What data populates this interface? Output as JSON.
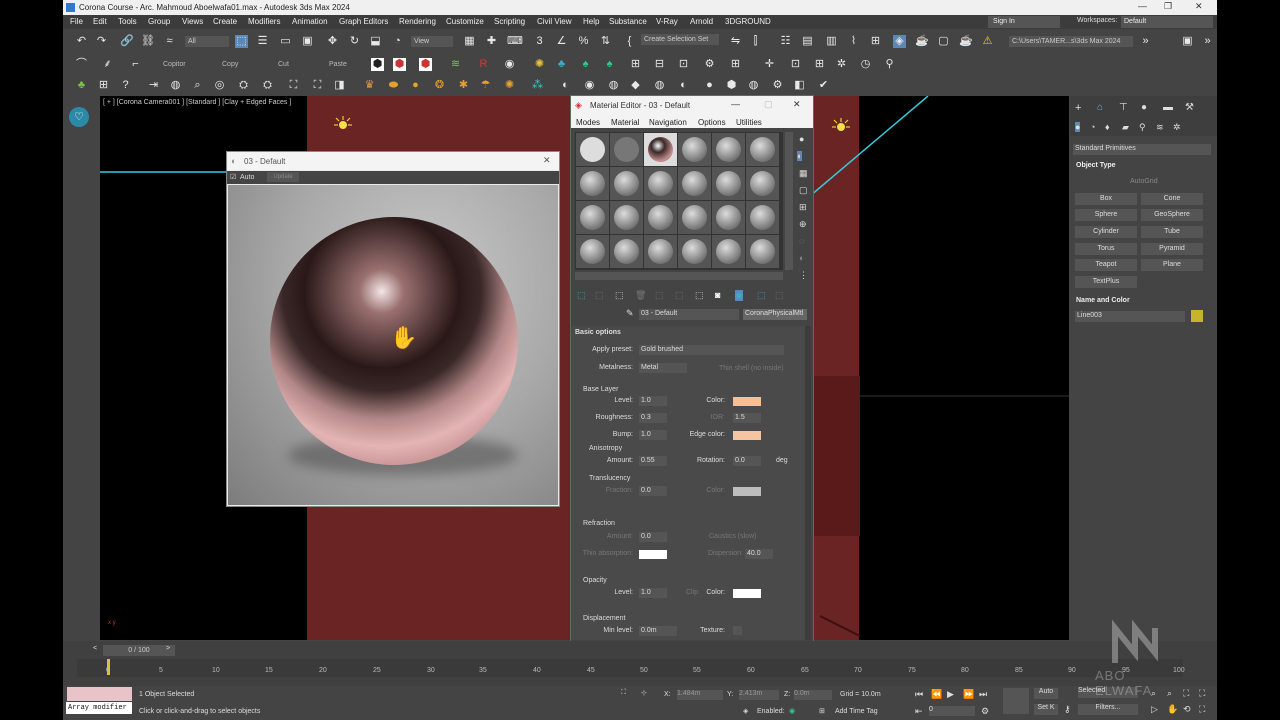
{
  "title_bar": {
    "text": "Corona Course - Arc. Mahmoud Aboelwafa01.max - Autodesk 3ds Max 2024",
    "controls": [
      "—",
      "❐",
      "✕"
    ]
  },
  "menu": {
    "items": [
      "File",
      "Edit",
      "Tools",
      "Group",
      "Views",
      "Create",
      "Modifiers",
      "Animation",
      "Graph Editors",
      "Rendering",
      "Customize",
      "Scripting",
      "Civil View",
      "Help",
      "Substance",
      "V-Ray",
      "Arnold",
      "3DGROUND"
    ],
    "sign_in": "Sign In",
    "workspaces_label": "Workspaces:",
    "workspaces_value": "Default"
  },
  "toolbar1": {
    "selection_filter": "All",
    "ref_coord": "View",
    "named_sel": "Create Selection Set",
    "path": "C:\\Users\\TAMER...s\\3ds Max 2024"
  },
  "toolbar2": {
    "labels": [
      "Copitor",
      "Copy",
      "Cut",
      "Paste"
    ]
  },
  "viewport": {
    "label": "[ + ] [Corona Camera001 ] [Standard ] [Clay + Edged Faces ]",
    "axis_label": "x y"
  },
  "preview_window": {
    "title": "03 - Default",
    "auto_label": "Auto",
    "update_label": "Update"
  },
  "material_editor": {
    "title": "Material Editor - 03 - Default",
    "menu": [
      "Modes",
      "Material",
      "Navigation",
      "Options",
      "Utilities"
    ],
    "material_name": "03 - Default",
    "material_type": "CoronaPhysicalMtl",
    "basic_options": "Basic options",
    "apply_preset_label": "Apply preset:",
    "apply_preset_value": "Gold brushed",
    "metalness_label": "Metalness:",
    "metalness_value": "Metal",
    "thin_shell": "Thin shell (no inside)",
    "base_layer": "Base Layer",
    "level_label": "Level:",
    "level_value": "1.0",
    "color_label": "Color:",
    "roughness_label": "Roughness:",
    "roughness_value": "0.3",
    "ior_label": "IOR:",
    "ior_value": "1.5",
    "bump_label": "Bump:",
    "bump_value": "1.0",
    "edge_color_label": "Edge color:",
    "anisotropy": "Anisotropy",
    "amount_label": "Amount:",
    "amount_value": "0.55",
    "rotation_label": "Rotation:",
    "rotation_value": "0.0",
    "rotation_unit": "deg",
    "translucency": "Translucency",
    "fraction_label": "Fraction:",
    "fraction_value": "0.0",
    "trans_color_label": "Color:",
    "refraction": "Refraction",
    "refr_amount_label": "Amount:",
    "refr_amount_value": "0.0",
    "caustics_label": "Caustics (slow)",
    "thin_absorption_label": "Thin absorption:",
    "dispersion_label": "Dispersion:",
    "dispersion_value": "40.0",
    "opacity": "Opacity",
    "op_level_label": "Level:",
    "op_level_value": "1.0",
    "clip_label": "Clip",
    "op_color_label": "Color:",
    "displacement": "Displacement",
    "min_level_label": "Min level:",
    "min_level_value": "0.0m",
    "texture_label": "Texture:",
    "colors": {
      "base": "#f7c08e",
      "edge": "#f5c4a0",
      "trans": "#bdbdbd",
      "white": "#ffffff"
    }
  },
  "command_panel": {
    "category": "Standard Primitives",
    "object_type": "Object Type",
    "autogrid": "AutoGrid",
    "buttons": [
      "Box",
      "Cone",
      "Sphere",
      "GeoSphere",
      "Cylinder",
      "Tube",
      "Torus",
      "Pyramid",
      "Teapot",
      "Plane",
      "TextPlus"
    ],
    "name_and_color": "Name and Color",
    "object_name": "Line003",
    "object_color": "#c8b42a"
  },
  "timeline": {
    "frame": "0 / 100",
    "ticks": [
      "0",
      "5",
      "10",
      "15",
      "20",
      "25",
      "30",
      "35",
      "40",
      "45",
      "50",
      "55",
      "60",
      "65",
      "70",
      "75",
      "80",
      "85",
      "90",
      "95",
      "100"
    ]
  },
  "status": {
    "array_modifier": "Array modifier",
    "selected": "1 Object Selected",
    "hint": "Click or click-and-drag to select objects",
    "x_label": "X:",
    "x_value": "1.484m",
    "y_label": "Y:",
    "y_value": "2.413m",
    "z_label": "Z:",
    "z_value": "0.0m",
    "grid": "Grid = 10.0m",
    "enabled": "Enabled:",
    "add_time_tag": "Add Time Tag",
    "auto": "Auto",
    "setk": "Set K",
    "key_filter": "Selected",
    "filters": "Filters...",
    "frame_field": "0"
  },
  "watermark": "ABO ELWAFA"
}
